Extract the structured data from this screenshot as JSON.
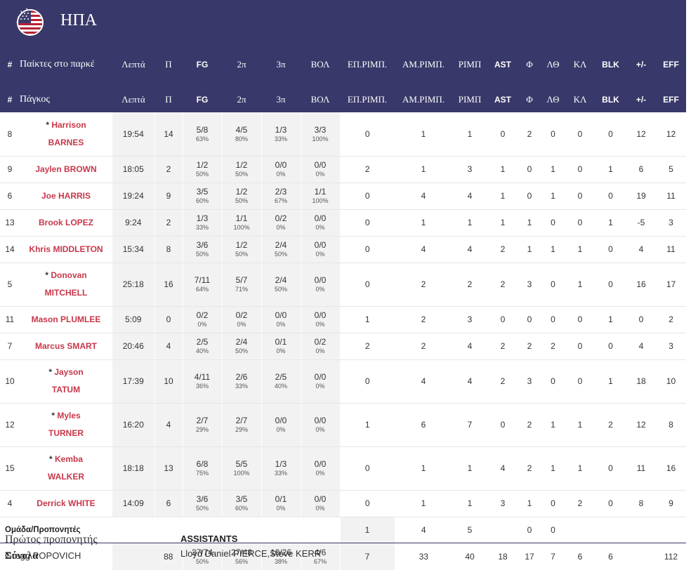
{
  "team": {
    "name": "ΗΠΑ"
  },
  "columns": {
    "num": "#",
    "starters": "Παίκτες στο παρκέ",
    "bench": "Πάγκος",
    "minutes": "Λεπτά",
    "points": "Π",
    "fg": "FG",
    "two": "2π",
    "three": "3π",
    "ft": "ΒΟΛ",
    "oreb": "ΕΠ.ΡΙΜΠ.",
    "dreb": "ΑΜ.ΡΙΜΠ.",
    "reb": "ΡΙΜΠ",
    "ast": "AST",
    "pf": "Φ",
    "to": "ΛΘ",
    "stl": "ΚΛ",
    "blk": "BLK",
    "pm": "+/-",
    "eff": "EFF"
  },
  "players": [
    {
      "num": "8",
      "star": "*",
      "first": "Harrison",
      "last": "BARNES",
      "min": "19:54",
      "pts": "14",
      "fg": "5/8",
      "fgp": "63%",
      "two": "4/5",
      "twop": "80%",
      "three": "1/3",
      "threep": "33%",
      "ft": "3/3",
      "ftp": "100%",
      "oreb": "0",
      "dreb": "1",
      "reb": "1",
      "ast": "0",
      "pf": "2",
      "to": "0",
      "stl": "0",
      "blk": "0",
      "pm": "12",
      "eff": "12"
    },
    {
      "num": "9",
      "star": "",
      "first": "Jaylen",
      "last": "BROWN",
      "min": "18:05",
      "pts": "2",
      "fg": "1/2",
      "fgp": "50%",
      "two": "1/2",
      "twop": "50%",
      "three": "0/0",
      "threep": "0%",
      "ft": "0/0",
      "ftp": "0%",
      "oreb": "2",
      "dreb": "1",
      "reb": "3",
      "ast": "1",
      "pf": "0",
      "to": "1",
      "stl": "0",
      "blk": "1",
      "pm": "6",
      "eff": "5"
    },
    {
      "num": "6",
      "star": "",
      "first": "Joe",
      "last": "HARRIS",
      "min": "19:24",
      "pts": "9",
      "fg": "3/5",
      "fgp": "60%",
      "two": "1/2",
      "twop": "50%",
      "three": "2/3",
      "threep": "67%",
      "ft": "1/1",
      "ftp": "100%",
      "oreb": "0",
      "dreb": "4",
      "reb": "4",
      "ast": "1",
      "pf": "0",
      "to": "1",
      "stl": "0",
      "blk": "0",
      "pm": "19",
      "eff": "11"
    },
    {
      "num": "13",
      "star": "",
      "first": "Brook",
      "last": "LOPEZ",
      "min": "9:24",
      "pts": "2",
      "fg": "1/3",
      "fgp": "33%",
      "two": "1/1",
      "twop": "100%",
      "three": "0/2",
      "threep": "0%",
      "ft": "0/0",
      "ftp": "0%",
      "oreb": "0",
      "dreb": "1",
      "reb": "1",
      "ast": "1",
      "pf": "1",
      "to": "0",
      "stl": "0",
      "blk": "1",
      "pm": "-5",
      "eff": "3"
    },
    {
      "num": "14",
      "star": "",
      "first": "Khris",
      "last": "MIDDLETON",
      "min": "15:34",
      "pts": "8",
      "fg": "3/6",
      "fgp": "50%",
      "two": "1/2",
      "twop": "50%",
      "three": "2/4",
      "threep": "50%",
      "ft": "0/0",
      "ftp": "0%",
      "oreb": "0",
      "dreb": "4",
      "reb": "4",
      "ast": "2",
      "pf": "1",
      "to": "1",
      "stl": "1",
      "blk": "0",
      "pm": "4",
      "eff": "11"
    },
    {
      "num": "5",
      "star": "*",
      "first": "Donovan",
      "last": "MITCHELL",
      "min": "25:18",
      "pts": "16",
      "fg": "7/11",
      "fgp": "64%",
      "two": "5/7",
      "twop": "71%",
      "three": "2/4",
      "threep": "50%",
      "ft": "0/0",
      "ftp": "0%",
      "oreb": "0",
      "dreb": "2",
      "reb": "2",
      "ast": "2",
      "pf": "3",
      "to": "0",
      "stl": "1",
      "blk": "0",
      "pm": "16",
      "eff": "17"
    },
    {
      "num": "11",
      "star": "",
      "first": "Mason",
      "last": "PLUMLEE",
      "min": "5:09",
      "pts": "0",
      "fg": "0/2",
      "fgp": "0%",
      "two": "0/2",
      "twop": "0%",
      "three": "0/0",
      "threep": "0%",
      "ft": "0/0",
      "ftp": "0%",
      "oreb": "1",
      "dreb": "2",
      "reb": "3",
      "ast": "0",
      "pf": "0",
      "to": "0",
      "stl": "0",
      "blk": "1",
      "pm": "0",
      "eff": "2"
    },
    {
      "num": "7",
      "star": "",
      "first": "Marcus",
      "last": "SMART",
      "min": "20:46",
      "pts": "4",
      "fg": "2/5",
      "fgp": "40%",
      "two": "2/4",
      "twop": "50%",
      "three": "0/1",
      "threep": "0%",
      "ft": "0/2",
      "ftp": "0%",
      "oreb": "2",
      "dreb": "2",
      "reb": "4",
      "ast": "2",
      "pf": "2",
      "to": "2",
      "stl": "0",
      "blk": "0",
      "pm": "4",
      "eff": "3"
    },
    {
      "num": "10",
      "star": "*",
      "first": "Jayson",
      "last": "TATUM",
      "min": "17:39",
      "pts": "10",
      "fg": "4/11",
      "fgp": "36%",
      "two": "2/6",
      "twop": "33%",
      "three": "2/5",
      "threep": "40%",
      "ft": "0/0",
      "ftp": "0%",
      "oreb": "0",
      "dreb": "4",
      "reb": "4",
      "ast": "2",
      "pf": "3",
      "to": "0",
      "stl": "0",
      "blk": "1",
      "pm": "18",
      "eff": "10"
    },
    {
      "num": "12",
      "star": "*",
      "first": "Myles",
      "last": "TURNER",
      "min": "16:20",
      "pts": "4",
      "fg": "2/7",
      "fgp": "29%",
      "two": "2/7",
      "twop": "29%",
      "three": "0/0",
      "threep": "0%",
      "ft": "0/0",
      "ftp": "0%",
      "oreb": "1",
      "dreb": "6",
      "reb": "7",
      "ast": "0",
      "pf": "2",
      "to": "1",
      "stl": "1",
      "blk": "2",
      "pm": "12",
      "eff": "8"
    },
    {
      "num": "15",
      "star": "*",
      "first": "Kemba",
      "last": "WALKER",
      "min": "18:18",
      "pts": "13",
      "fg": "6/8",
      "fgp": "75%",
      "two": "5/5",
      "twop": "100%",
      "three": "1/3",
      "threep": "33%",
      "ft": "0/0",
      "ftp": "0%",
      "oreb": "0",
      "dreb": "1",
      "reb": "1",
      "ast": "4",
      "pf": "2",
      "to": "1",
      "stl": "1",
      "blk": "0",
      "pm": "11",
      "eff": "16"
    },
    {
      "num": "4",
      "star": "",
      "first": "Derrick",
      "last": "WHITE",
      "min": "14:09",
      "pts": "6",
      "fg": "3/6",
      "fgp": "50%",
      "two": "3/5",
      "twop": "60%",
      "three": "0/1",
      "threep": "0%",
      "ft": "0/0",
      "ftp": "0%",
      "oreb": "0",
      "dreb": "1",
      "reb": "1",
      "ast": "3",
      "pf": "1",
      "to": "0",
      "stl": "2",
      "blk": "0",
      "pm": "8",
      "eff": "9"
    }
  ],
  "team_row": {
    "label": "Ομάδα/Προπονητές",
    "oreb": "1",
    "dreb": "4",
    "reb": "5",
    "pf": "0",
    "to": "0"
  },
  "totals": {
    "label": "Σύνολα",
    "pts": "88",
    "fg": "37/74",
    "fgp": "50%",
    "two": "27/48",
    "twop": "56%",
    "three": "10/26",
    "threep": "38%",
    "ft": "4/6",
    "ftp": "67%",
    "oreb": "7",
    "dreb": "33",
    "reb": "40",
    "ast": "18",
    "pf": "17",
    "to": "7",
    "stl": "6",
    "blk": "6",
    "eff": "112"
  },
  "coach": {
    "label": "Πρώτος προπονητής",
    "name": "Gregg POPOVICH"
  },
  "assistants": {
    "label": "ASSISTANTS",
    "names": "Lloyd Daniel PIERCE,Steve KERR"
  },
  "colors": {
    "header_bg": "#38386a",
    "player_name": "#c8374a"
  }
}
